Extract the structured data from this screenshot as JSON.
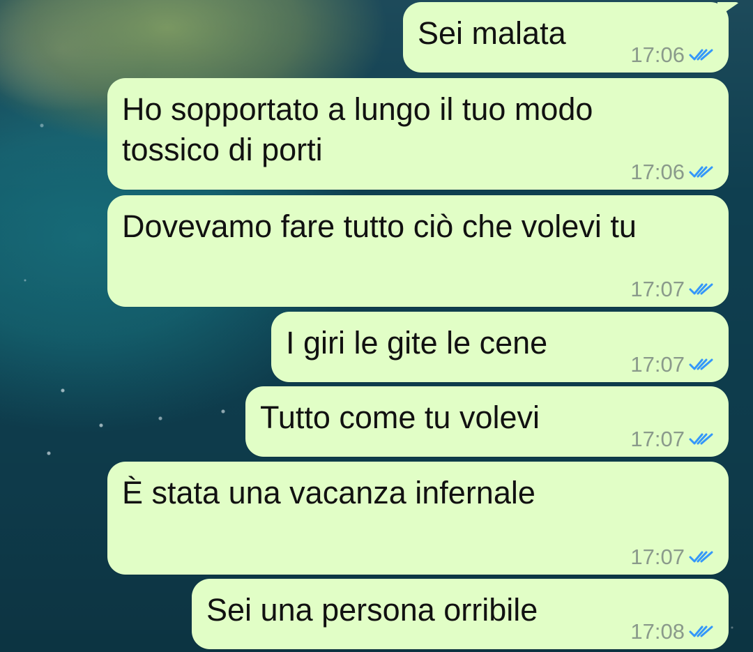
{
  "chat": {
    "messages": [
      {
        "text": "Sei malata",
        "time": "17:06",
        "status": "read",
        "status_icon": "double-check-icon"
      },
      {
        "text": "Ho sopportato a lungo il tuo modo tossico di porti",
        "time": "17:06",
        "status": "read",
        "status_icon": "double-check-icon"
      },
      {
        "text": "Dovevamo fare tutto ciò che volevi tu",
        "time": "17:07",
        "status": "read",
        "status_icon": "double-check-icon"
      },
      {
        "text": "I giri le gite le cene",
        "time": "17:07",
        "status": "read",
        "status_icon": "double-check-icon"
      },
      {
        "text": "Tutto come tu volevi",
        "time": "17:07",
        "status": "read",
        "status_icon": "double-check-icon"
      },
      {
        "text": "È stata una vacanza infernale",
        "time": "17:07",
        "status": "read",
        "status_icon": "double-check-icon"
      },
      {
        "text": "Sei una persona orribile",
        "time": "17:08",
        "status": "read",
        "status_icon": "double-check-icon"
      }
    ]
  },
  "colors": {
    "outgoing_bubble": "#e1fec6",
    "message_text": "#111111",
    "timestamp": "#8a9a8b",
    "read_receipt": "#3497f9"
  }
}
